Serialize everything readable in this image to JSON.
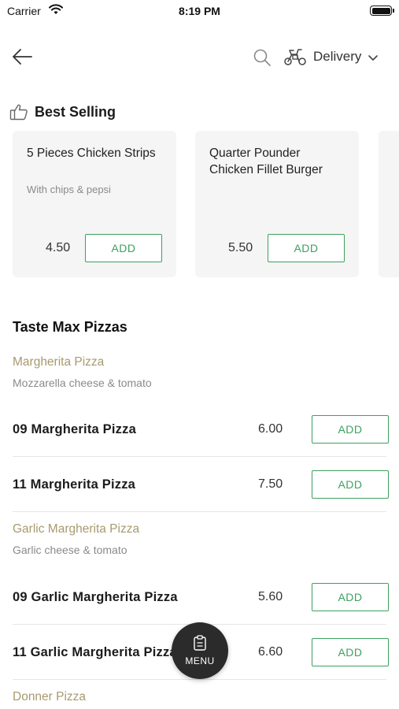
{
  "status_bar": {
    "carrier": "Carrier",
    "time": "8:19 PM"
  },
  "nav": {
    "delivery_label": "Delivery"
  },
  "best_selling": {
    "title": "Best Selling",
    "items": [
      {
        "name": "5 Pieces Chicken Strips",
        "description": "With chips & pepsi",
        "price": "4.50",
        "add_label": "ADD"
      },
      {
        "name": "Quarter Pounder Chicken Fillet Burger",
        "description": "",
        "price": "5.50",
        "add_label": "ADD"
      }
    ]
  },
  "section": {
    "title": "Taste Max Pizzas",
    "groups": [
      {
        "title": "Margherita Pizza",
        "description": "Mozzarella cheese & tomato",
        "items": [
          {
            "name": "09 Margherita Pizza",
            "price": "6.00",
            "add_label": "ADD"
          },
          {
            "name": "11 Margherita Pizza",
            "price": "7.50",
            "add_label": "ADD"
          }
        ]
      },
      {
        "title": "Garlic Margherita Pizza",
        "description": "Garlic cheese & tomato",
        "items": [
          {
            "name": "09 Garlic Margherita Pizza",
            "price": "5.60",
            "add_label": "ADD"
          },
          {
            "name": "11 Garlic Margherita Pizza",
            "price": "6.60",
            "add_label": "ADD"
          }
        ]
      },
      {
        "title": "Donner Pizza"
      }
    ]
  },
  "fab": {
    "label": "MENU"
  },
  "colors": {
    "accent": "#3ea060",
    "group_title": "#a89a6e",
    "card_bg": "#f5f5f5",
    "fab_bg": "#2b2b2b"
  },
  "icons": [
    "back-arrow",
    "search",
    "scooter",
    "chevron-down",
    "thumbs-up",
    "clipboard"
  ]
}
